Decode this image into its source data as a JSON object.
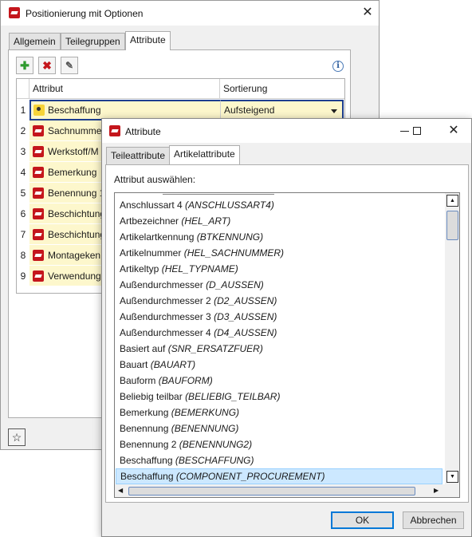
{
  "back_window": {
    "title": "Positionierung mit Optionen",
    "tabs": [
      "Allgemein",
      "Teilegruppen",
      "Attribute"
    ],
    "active_tab": "Attribute",
    "toolbar": {
      "add_icon": "plus-icon",
      "delete_icon": "delete-x-icon",
      "edit_icon": "edit-icon",
      "info_icon": "info-icon"
    },
    "grid": {
      "columns": [
        "Attribut",
        "Sortierung"
      ],
      "rows": [
        {
          "num": "1",
          "attr": "Beschaffung",
          "sort": "Aufsteigend",
          "icon": "special-attribute-icon"
        },
        {
          "num": "2",
          "attr": "Sachnummer",
          "sort": ""
        },
        {
          "num": "3",
          "attr": "Werkstoff/M",
          "sort": ""
        },
        {
          "num": "4",
          "attr": "Bemerkung",
          "sort": ""
        },
        {
          "num": "5",
          "attr": "Benennung 1",
          "sort": ""
        },
        {
          "num": "6",
          "attr": "Beschichtung",
          "sort": ""
        },
        {
          "num": "7",
          "attr": "Beschichtung",
          "sort": ""
        },
        {
          "num": "8",
          "attr": "Montageken",
          "sort": ""
        },
        {
          "num": "9",
          "attr": "Verwendung",
          "sort": ""
        }
      ]
    },
    "star_icon": "star-icon"
  },
  "dialog": {
    "title": "Attribute",
    "tabs": [
      "Teileattribute",
      "Artikelattribute"
    ],
    "active_tab": "Artikelattribute",
    "select_label": "Attribut auswählen:",
    "items": [
      {
        "label": "Anschlussart 4",
        "code": "(ANSCHLUSSART4)"
      },
      {
        "label": "Artbezeichner",
        "code": "(HEL_ART)"
      },
      {
        "label": "Artikelartkennung",
        "code": "(BTKENNUNG)"
      },
      {
        "label": "Artikelnummer",
        "code": "(HEL_SACHNUMMER)"
      },
      {
        "label": "Artikeltyp",
        "code": "(HEL_TYPNAME)"
      },
      {
        "label": "Außendurchmesser",
        "code": "(D_AUSSEN)"
      },
      {
        "label": "Außendurchmesser 2",
        "code": "(D2_AUSSEN)"
      },
      {
        "label": "Außendurchmesser 3",
        "code": "(D3_AUSSEN)"
      },
      {
        "label": "Außendurchmesser 4",
        "code": "(D4_AUSSEN)"
      },
      {
        "label": "Basiert auf",
        "code": "(SNR_ERSATZFUER)"
      },
      {
        "label": "Bauart",
        "code": "(BAUART)"
      },
      {
        "label": "Bauform",
        "code": "(BAUFORM)"
      },
      {
        "label": "Beliebig teilbar",
        "code": "(BELIEBIG_TEILBAR)"
      },
      {
        "label": "Bemerkung",
        "code": "(BEMERKUNG)"
      },
      {
        "label": "Benennung",
        "code": "(BENENNUNG)"
      },
      {
        "label": "Benennung 2",
        "code": "(BENENNUNG2)"
      },
      {
        "label": "Beschaffung",
        "code": "(BESCHAFFUNG)"
      },
      {
        "label": "Beschaffung",
        "code": "(COMPONENT_PROCUREMENT)"
      }
    ],
    "selected_index": 17,
    "ok_label": "OK",
    "cancel_label": "Abbrechen"
  },
  "colors": {
    "row_highlight": "#fdf7cc",
    "selection": "#cce8ff",
    "brand_red": "#c4161c"
  }
}
